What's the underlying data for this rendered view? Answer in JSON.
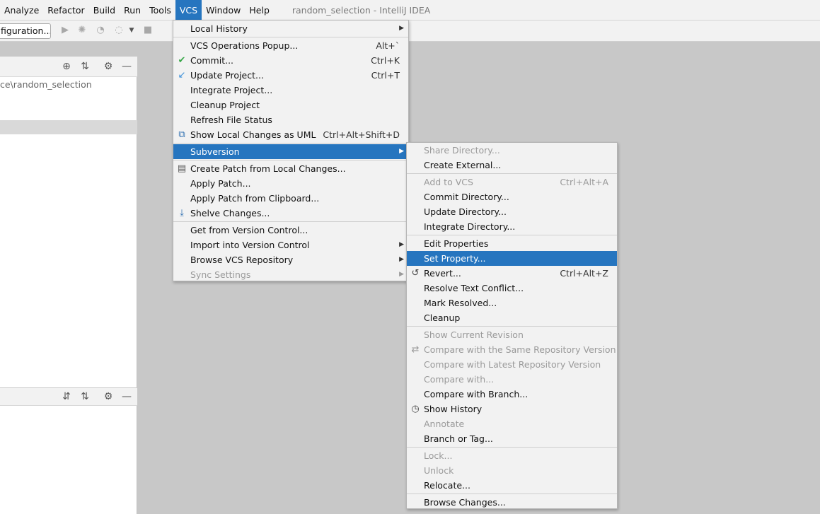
{
  "window": {
    "title": "random_selection - IntelliJ IDEA"
  },
  "menubar": {
    "items": [
      {
        "label": "Analyze"
      },
      {
        "label": "Refactor"
      },
      {
        "label": "Build"
      },
      {
        "label": "Run"
      },
      {
        "label": "Tools"
      },
      {
        "label": "VCS",
        "active": true
      },
      {
        "label": "Window"
      },
      {
        "label": "Help"
      }
    ]
  },
  "toolbar": {
    "config_label": "figuration...",
    "icons": [
      "run-icon",
      "debug-icon",
      "coverage-icon",
      "profile-icon",
      "dropdown-icon",
      "stop-icon"
    ]
  },
  "left_panel": {
    "path_text": "ce\\random_selection",
    "header_icons": [
      "locate-icon",
      "collapse-icon",
      "gear-icon",
      "minimize-icon"
    ],
    "bottom_header_icons": [
      "expand-icon",
      "collapse-icon",
      "gear-icon",
      "minimize-icon"
    ]
  },
  "vcs_menu": {
    "items": [
      {
        "label": "Local History",
        "arrow": true
      },
      {
        "label": "VCS Operations Popup...",
        "shortcut": "Alt+`"
      },
      {
        "label": "Commit...",
        "shortcut": "Ctrl+K",
        "icon": "check-icon",
        "icon_color": "#3aa84a"
      },
      {
        "label": "Update Project...",
        "shortcut": "Ctrl+T",
        "icon": "update-arrow-icon",
        "icon_color": "#3a8fd8"
      },
      {
        "label": "Integrate Project..."
      },
      {
        "label": "Cleanup Project"
      },
      {
        "label": "Refresh File Status"
      },
      {
        "label": "Show Local Changes as UML",
        "shortcut": "Ctrl+Alt+Shift+D",
        "icon": "uml-icon",
        "icon_color": "#2e6fb0"
      },
      {
        "label": "Subversion",
        "arrow": true,
        "selected": true
      },
      {
        "label": "Create Patch from Local Changes...",
        "icon": "patch-icon",
        "icon_color": "#555555"
      },
      {
        "label": "Apply Patch..."
      },
      {
        "label": "Apply Patch from Clipboard..."
      },
      {
        "label": "Shelve Changes...",
        "icon": "shelve-icon",
        "icon_color": "#2e6fb0"
      },
      {
        "label": "Get from Version Control..."
      },
      {
        "label": "Import into Version Control",
        "arrow": true
      },
      {
        "label": "Browse VCS Repository",
        "arrow": true
      },
      {
        "label": "Sync Settings",
        "arrow": true,
        "disabled": true
      }
    ]
  },
  "subversion_menu": {
    "items": [
      {
        "label": "Share Directory...",
        "disabled": true
      },
      {
        "label": "Create External..."
      },
      {
        "label": "Add to VCS",
        "shortcut": "Ctrl+Alt+A",
        "disabled": true
      },
      {
        "label": "Commit Directory..."
      },
      {
        "label": "Update Directory..."
      },
      {
        "label": "Integrate Directory..."
      },
      {
        "label": "Edit Properties"
      },
      {
        "label": "Set Property...",
        "selected": true
      },
      {
        "label": "Revert...",
        "shortcut": "Ctrl+Alt+Z",
        "icon": "revert-icon",
        "icon_color": "#444444"
      },
      {
        "label": "Resolve Text Conflict..."
      },
      {
        "label": "Mark Resolved..."
      },
      {
        "label": "Cleanup"
      },
      {
        "label": "Show Current Revision",
        "disabled": true
      },
      {
        "label": "Compare with the Same Repository Version",
        "disabled": true,
        "icon": "compare-icon",
        "icon_color": "#9a9a9a"
      },
      {
        "label": "Compare with Latest Repository Version",
        "disabled": true
      },
      {
        "label": "Compare with...",
        "disabled": true
      },
      {
        "label": "Compare with Branch..."
      },
      {
        "label": "Show History",
        "icon": "clock-icon",
        "icon_color": "#444444"
      },
      {
        "label": "Annotate",
        "disabled": true
      },
      {
        "label": "Branch or Tag..."
      },
      {
        "label": "Lock...",
        "disabled": true
      },
      {
        "label": "Unlock",
        "disabled": true
      },
      {
        "label": "Relocate..."
      },
      {
        "label": "Browse Changes..."
      }
    ]
  }
}
